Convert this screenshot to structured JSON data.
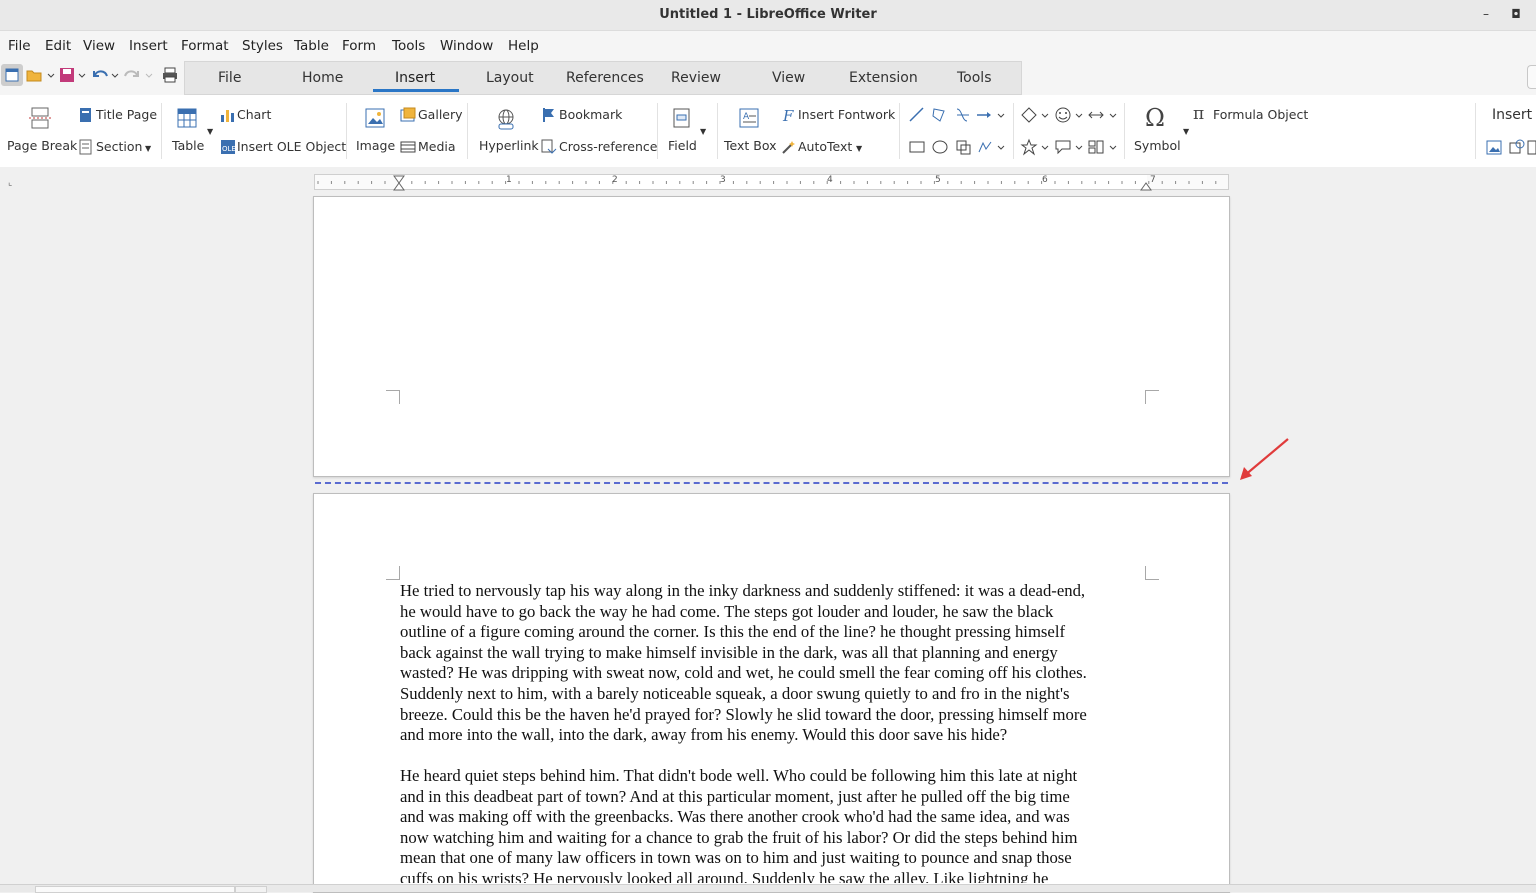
{
  "window": {
    "title": "Untitled 1 - LibreOffice Writer",
    "minimize": "–",
    "close": "◘"
  },
  "menu": [
    "File",
    "Edit",
    "View",
    "Insert",
    "Format",
    "Styles",
    "Table",
    "Form",
    "Tools",
    "Window",
    "Help"
  ],
  "tabs": [
    "File",
    "Home",
    "Insert",
    "Layout",
    "References",
    "Review",
    "View",
    "Extension",
    "Tools"
  ],
  "active_tab": "Insert",
  "ribbon": {
    "page_break": "Page Break",
    "title_page": "Title Page",
    "section": "Section",
    "table": "Table",
    "chart": "Chart",
    "insert_ole": "Insert OLE Object",
    "image": "Image",
    "gallery": "Gallery",
    "media": "Media",
    "hyperlink": "Hyperlink",
    "bookmark": "Bookmark",
    "cross_reference": "Cross-reference",
    "field": "Field",
    "text_box": "Text Box",
    "insert_fontwork": "Insert Fontwork",
    "autotext": "AutoText",
    "symbol": "Symbol",
    "formula_object": "Formula Object",
    "insert_right": "Insert"
  },
  "document": {
    "para1_lines": [
      "He tried to nervously tap his way along in the inky darkness and suddenly stiffened: it was a dead-end,",
      "he would have to go back the way he had come. The steps got louder and louder, he saw the black",
      "outline of a figure coming around the corner. Is this the end of the line? he thought pressing himself",
      "back against the wall trying to make himself invisible in the dark, was all that planning and energy",
      "wasted? He was dripping with sweat now, cold and wet, he could smell the fear coming off his clothes.",
      "Suddenly next to him, with a barely noticeable squeak, a door swung quietly to and fro in the night's",
      "breeze. Could this be the haven he'd prayed for? Slowly he slid toward the door, pressing himself more",
      "and more into the wall, into the dark, away from his enemy. Would this door save his hide?"
    ],
    "para2_lines": [
      "He heard quiet steps behind him. That didn't bode well. Who could be following him this late at night",
      "and in this deadbeat part of town? And at this particular moment, just after he pulled off the big time",
      "and was making off with the greenbacks. Was there another crook who'd had the same idea, and was",
      "now watching him and waiting for a chance to grab the fruit of his labor? Or did the steps behind him",
      "mean that one of many law officers in town was on to him and just waiting to pounce and snap those",
      "cuffs on his wrists? He nervously looked all around. Suddenly he saw the alley. Like lightning he"
    ]
  },
  "ruler": {
    "numbers": [
      "1",
      "2",
      "3",
      "4",
      "5",
      "6",
      "7"
    ]
  },
  "colors": {
    "accent": "#2a76c6",
    "page_break_line": "#5b6bd0",
    "arrow": "#e03b3b"
  }
}
